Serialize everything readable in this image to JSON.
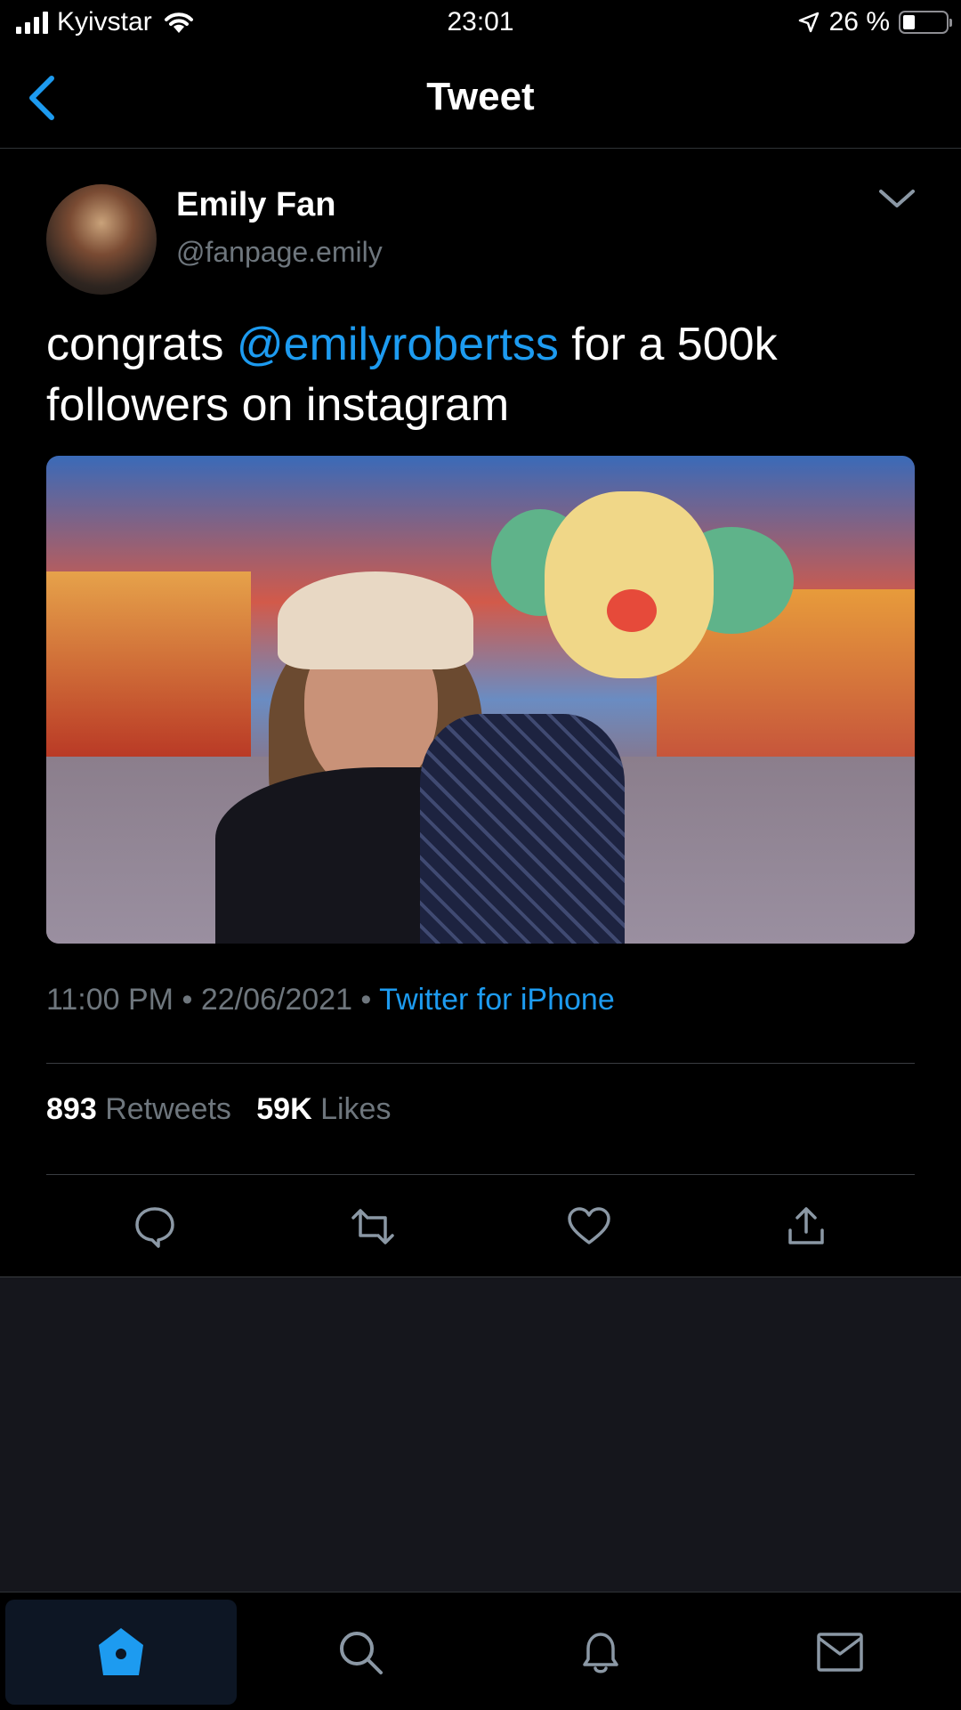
{
  "status_bar": {
    "carrier": "Kyivstar",
    "time": "23:01",
    "battery": "26 %"
  },
  "nav": {
    "title": "Tweet"
  },
  "tweet": {
    "author_name": "Emily Fan",
    "author_handle": "@fanpage.emily",
    "text_before": "congrats ",
    "mention": "@emilyrobertss",
    "text_after": " for a 500k followers on instagram",
    "time": "11:00 PM",
    "date": "22/06/2021",
    "source": "Twitter for iPhone",
    "separator": " • ",
    "retweets_count": "893",
    "retweets_label": "Retweets",
    "likes_count": "59K",
    "likes_label": "Likes"
  },
  "colors": {
    "accent": "#1d9bf0",
    "muted": "#6e767d",
    "background": "#000000"
  },
  "icons": {
    "actions": [
      "reply-icon",
      "retweet-icon",
      "like-icon",
      "share-icon"
    ],
    "tabs": [
      "home-icon",
      "search-icon",
      "notifications-icon",
      "messages-icon"
    ]
  }
}
